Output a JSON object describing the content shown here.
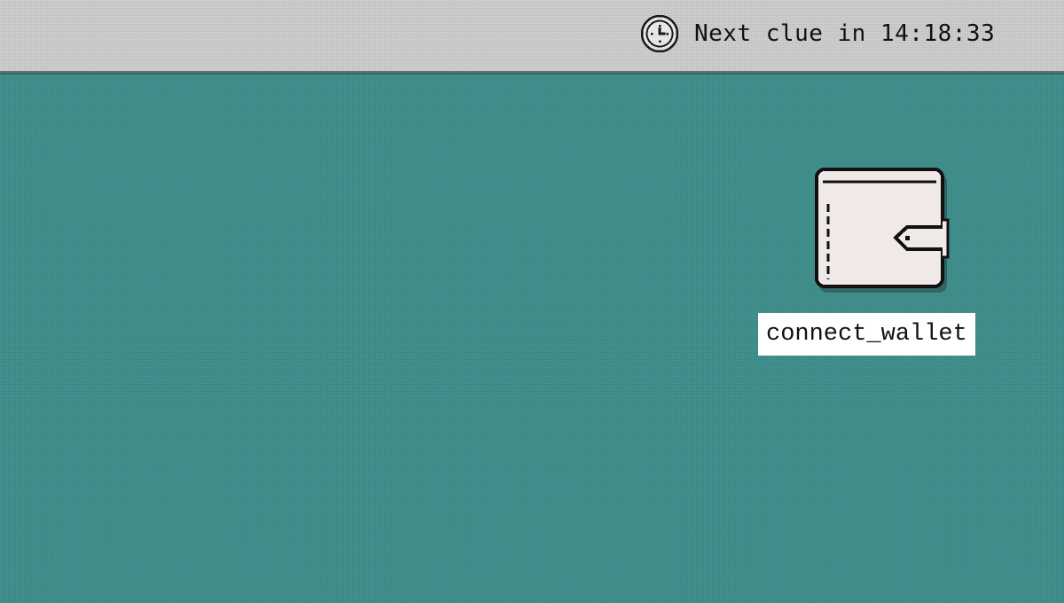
{
  "menubar": {
    "clock_icon": "clock-icon",
    "timer_prefix": "Next clue in",
    "timer_value": "14:18:33"
  },
  "desktop": {
    "background_color": "#3d8f8c",
    "icons": [
      {
        "label": "connect_wallet",
        "icon": "wallet-icon"
      }
    ]
  }
}
